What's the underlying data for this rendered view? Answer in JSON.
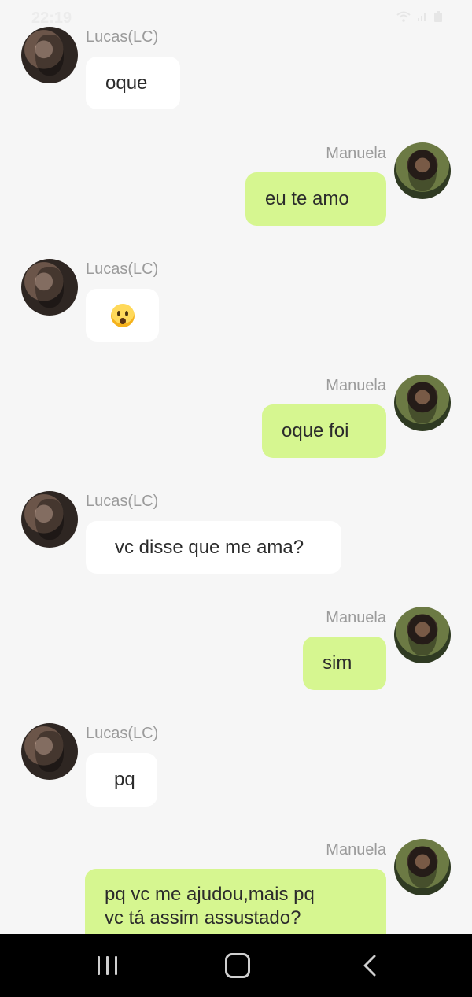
{
  "status_bar": {
    "time": "22:19"
  },
  "messages": [
    {
      "sender": "Lucas(LC)",
      "text": "oque",
      "side": "incoming"
    },
    {
      "sender": "Manuela",
      "text": "eu te amo",
      "side": "outgoing"
    },
    {
      "sender": "Lucas(LC)",
      "emoji": "hushed-face-emoji",
      "side": "incoming"
    },
    {
      "sender": "Manuela",
      "text": "oque foi",
      "side": "outgoing"
    },
    {
      "sender": "Lucas(LC)",
      "text": "vc disse que me ama?",
      "side": "incoming"
    },
    {
      "sender": "Manuela",
      "text": "sim",
      "side": "outgoing"
    },
    {
      "sender": "Lucas(LC)",
      "text": "pq",
      "side": "incoming"
    },
    {
      "sender": "Manuela",
      "text_lines": [
        "pq vc me ajudou,mais pq",
        "vc tá assim assustado?"
      ],
      "side": "outgoing"
    }
  ],
  "colors": {
    "background": "#f6f6f6",
    "incoming_bubble": "#ffffff",
    "outgoing_bubble": "#d6f690",
    "sender_name": "#9b9b9b",
    "nav_bar": "#000000"
  },
  "icons": {
    "status": [
      "wifi-icon",
      "signal-icon",
      "battery-icon"
    ],
    "nav": [
      "recents-icon",
      "home-icon",
      "back-icon"
    ]
  }
}
